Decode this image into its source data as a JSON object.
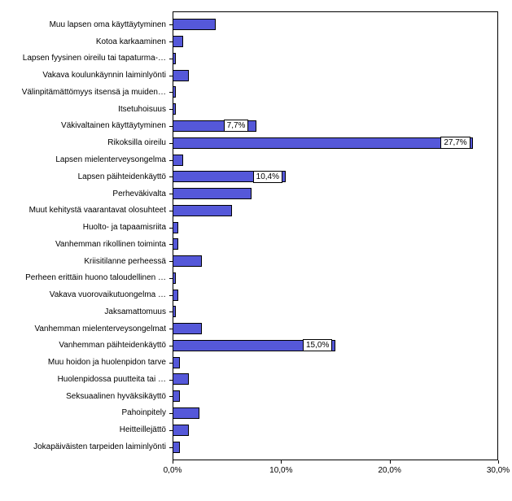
{
  "chart_data": {
    "type": "bar",
    "orientation": "horizontal",
    "xlabel": "",
    "ylabel": "",
    "xlim": [
      0,
      30
    ],
    "xticks": [
      0.0,
      10.0,
      20.0,
      30.0
    ],
    "xtick_labels": [
      "0,0%",
      "10,0%",
      "20,0%",
      "30,0%"
    ],
    "bar_color": "#5558d9",
    "categories": [
      "Muu lapsen oma käyttäytyminen",
      "Kotoa karkaaminen",
      "Lapsen fyysinen oireilu tai tapaturma-…",
      "Vakava koulunkäynnin laiminlyönti",
      "Välinpitämättömyys itsensä ja muiden…",
      "Itsetuhoisuus",
      "Väkivaltainen käyttäytyminen",
      "Rikoksilla oireilu",
      "Lapsen mielenterveysongelma",
      "Lapsen päihteidenkäyttö",
      "Perheväkivalta",
      "Muut kehitystä vaarantavat olosuhteet",
      "Huolto- ja tapaamisriita",
      "Vanhemman rikollinen toiminta",
      "Kriisitilanne perheessä",
      "Perheen erittäin huono taloudellinen …",
      "Vakava vuorovaikutuongelma …",
      "Jaksamattomuus",
      "Vanhemman mielenterveysongelmat",
      "Vanhemman päihteidenkäyttö",
      "Muu hoidon ja huolenpidon tarve",
      "Huolenpidossa puutteita tai …",
      "Seksuaalinen hyväksikäyttö",
      "Pahoinpitely",
      "Heitteillejättö",
      "Jokapäiväisten tarpeiden laiminlyönti"
    ],
    "values": [
      4.0,
      1.0,
      0.3,
      1.5,
      0.3,
      0.3,
      7.7,
      27.7,
      1.0,
      10.4,
      7.3,
      5.5,
      0.5,
      0.5,
      2.7,
      0.3,
      0.5,
      0.3,
      2.7,
      15.0,
      0.7,
      1.5,
      0.7,
      2.5,
      1.5,
      0.7
    ],
    "value_labels": [
      null,
      null,
      null,
      null,
      null,
      null,
      "7,7%",
      "27,7%",
      null,
      "10,4%",
      null,
      null,
      null,
      null,
      null,
      null,
      null,
      null,
      null,
      "15,0%",
      null,
      null,
      null,
      null,
      null,
      null
    ]
  }
}
